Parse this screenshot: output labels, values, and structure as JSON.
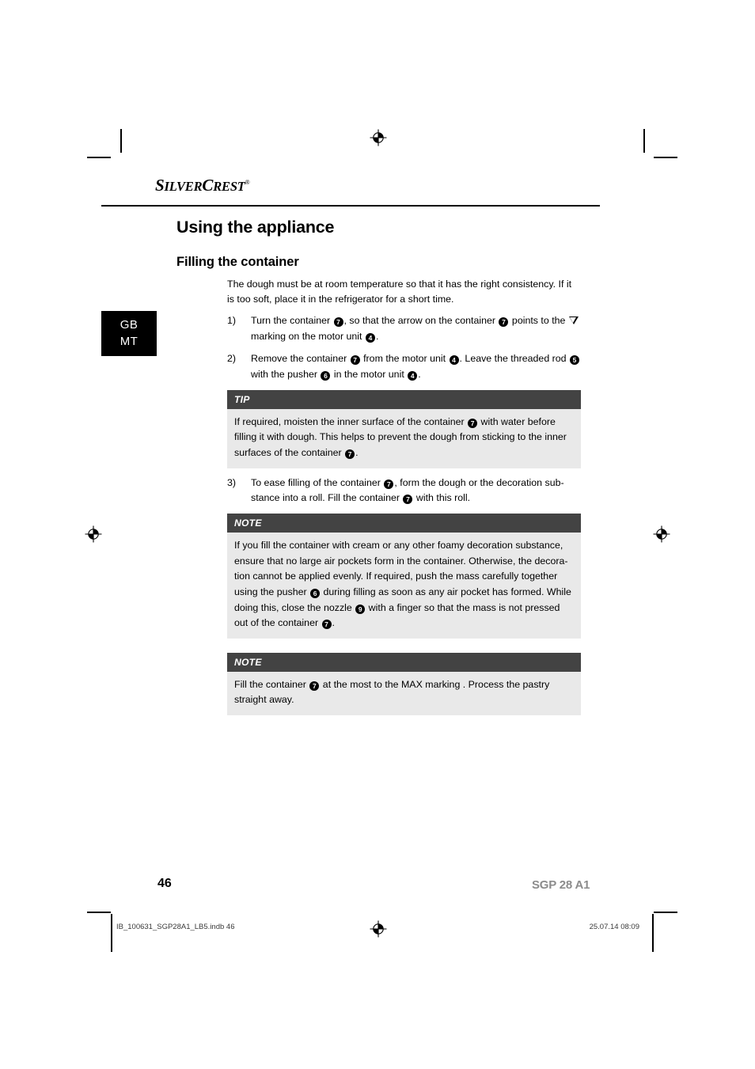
{
  "brand": {
    "name_parts": [
      "S",
      "ILVER",
      "C",
      "REST"
    ],
    "name": "SILVERCREST",
    "registered_mark": "®"
  },
  "language_tab": {
    "lines": [
      "GB",
      "MT"
    ]
  },
  "headings": {
    "h1": "Using the appliance",
    "h2": "Filling the container"
  },
  "intro": {
    "line1": "The dough must be at room temperature so that it has the right consistency.",
    "line2": "If it is too soft, place it in the refrigerator for a short time."
  },
  "steps": [
    {
      "number": "1)",
      "segments": [
        {
          "t": "text",
          "v": "Turn the container "
        },
        {
          "t": "marker",
          "v": "7"
        },
        {
          "t": "text",
          "v": ", so that the arrow on the container "
        },
        {
          "t": "marker",
          "v": "7"
        },
        {
          "t": "text",
          "v": " points to the "
        },
        {
          "t": "triangle",
          "v": "▽"
        },
        {
          "t": "text",
          "v": " marking on the motor unit "
        },
        {
          "t": "marker",
          "v": "4"
        },
        {
          "t": "text",
          "v": "."
        }
      ]
    },
    {
      "number": "2)",
      "segments": [
        {
          "t": "text",
          "v": "Remove the container "
        },
        {
          "t": "marker",
          "v": "7"
        },
        {
          "t": "text",
          "v": " from the motor unit "
        },
        {
          "t": "marker",
          "v": "4"
        },
        {
          "t": "text",
          "v": ". Leave the threaded rod "
        },
        {
          "t": "marker",
          "v": "5"
        },
        {
          "t": "text",
          "v": " with the pusher "
        },
        {
          "t": "marker",
          "v": "6"
        },
        {
          "t": "text",
          "v": " in the motor unit "
        },
        {
          "t": "marker",
          "v": "4"
        },
        {
          "t": "text",
          "v": "."
        }
      ]
    },
    {
      "number": "3)",
      "segments": [
        {
          "t": "text",
          "v": "To ease filling of the container "
        },
        {
          "t": "marker",
          "v": "7"
        },
        {
          "t": "text",
          "v": ", form the dough or the decoration sub-stance into a roll. Fill the container "
        },
        {
          "t": "marker",
          "v": "7"
        },
        {
          "t": "text",
          "v": " with this roll."
        }
      ]
    }
  ],
  "callout_boxes": [
    {
      "id": "tip-box",
      "title": "TIP",
      "segments": [
        {
          "t": "text",
          "v": "If required, moisten the inner surface of the container "
        },
        {
          "t": "marker",
          "v": "7"
        },
        {
          "t": "text",
          "v": " with water before filling it with dough. This helps to prevent the dough from sticking to the inner surfaces of the container "
        },
        {
          "t": "marker",
          "v": "7"
        },
        {
          "t": "text",
          "v": "."
        }
      ]
    },
    {
      "id": "note-box-1",
      "title": "NOTE",
      "segments": [
        {
          "t": "text",
          "v": "If you fill the container with cream or any other foamy decoration substance, ensure that no large air pockets form in the container. Otherwise, the decora-tion cannot be applied evenly. If required, push the mass carefully together using the pusher "
        },
        {
          "t": "marker",
          "v": "6"
        },
        {
          "t": "text",
          "v": " during filling as soon as any air pocket has formed. While doing this, close the nozzle "
        },
        {
          "t": "marker",
          "v": "9"
        },
        {
          "t": "text",
          "v": " with a finger so that the mass is not pressed out of the container "
        },
        {
          "t": "marker",
          "v": "7"
        },
        {
          "t": "text",
          "v": "."
        }
      ]
    },
    {
      "id": "note-box-2",
      "title": "NOTE",
      "segments": [
        {
          "t": "text",
          "v": "Fill the container "
        },
        {
          "t": "marker",
          "v": "7"
        },
        {
          "t": "text",
          "v": " at the most to the MAX marking . Process the pastry straight away."
        }
      ]
    }
  ],
  "footer": {
    "page_number": "46",
    "model": "SGP 28 A1",
    "imprint_file": "IB_100631_SGP28A1_LB5.indb   46",
    "imprint_date": "25.07.14   08:09"
  },
  "colors": {
    "callout_header_bg": "#434343",
    "callout_body_bg": "#e9e9e9",
    "model_gray": "#8c8c8c",
    "ink": "#000000",
    "tab_bg": "#000000"
  }
}
